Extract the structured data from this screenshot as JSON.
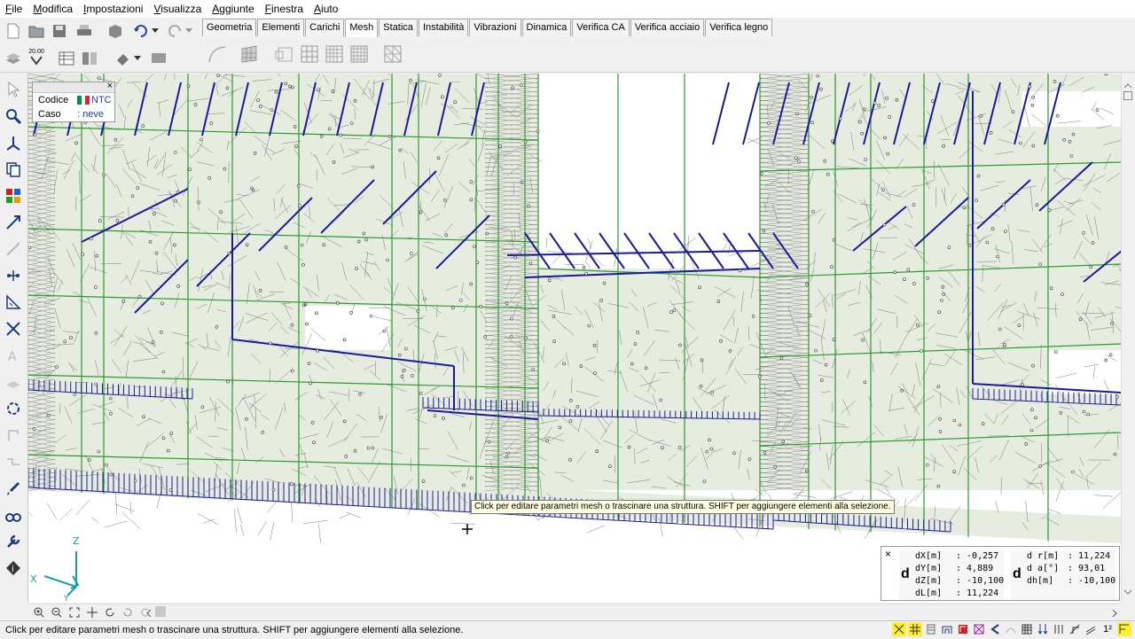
{
  "menu": {
    "items": [
      {
        "label": "File",
        "u": "F",
        "rest": "ile"
      },
      {
        "label": "Modifica",
        "u": "M",
        "rest": "odifica"
      },
      {
        "label": "Impostazioni",
        "u": "I",
        "rest": "mpostazioni"
      },
      {
        "label": "Visualizza",
        "u": "V",
        "rest": "isualizza"
      },
      {
        "label": "Aggiunte",
        "u": "A",
        "rest": "ggiunte"
      },
      {
        "label": "Finestra",
        "u": "F",
        "rest": "inestra"
      },
      {
        "label": "Aiuto",
        "u": "A",
        "rest": "iuto"
      }
    ]
  },
  "tabs": {
    "items": [
      "Geometria",
      "Elementi",
      "Carichi",
      "Mesh",
      "Statica",
      "Instabilità",
      "Vibrazioni",
      "Dinamica",
      "Verifica CA",
      "Verifica acciaio",
      "Verifica legno"
    ],
    "active": "Mesh"
  },
  "toolbar": {
    "zoom_value": "20.00"
  },
  "info_panel": {
    "codice_label": "Codice",
    "codice_value": "NTC",
    "caso_label": "Caso",
    "caso_value": ": neve",
    "close": "×"
  },
  "tooltip": "Click per editare parametri mesh o trascinare una struttura. SHIFT per aggiungere elementi alla selezione.",
  "status": "Click per editare parametri mesh o trascinare una struttura. SHIFT per aggiungere elementi alla selezione.",
  "coords": {
    "close": "×",
    "d_symbol": "d",
    "left": [
      {
        "k": "dX[m]",
        "v": ": -0,257"
      },
      {
        "k": "dY[m]",
        "v": ": 4,889"
      },
      {
        "k": "dZ[m]",
        "v": ": -10,100"
      },
      {
        "k": "dL[m]",
        "v": ": 11,224"
      }
    ],
    "right": [
      {
        "k": "d r[m]",
        "v": ": 11,224"
      },
      {
        "k": "d a[°]",
        "v": ": 93,01"
      },
      {
        "k": "dh[m]",
        "v": ": -10,100"
      }
    ]
  },
  "axes": {
    "z": "Z",
    "x": "X",
    "y": "Y"
  },
  "status_page": "1²",
  "colors": {
    "mesh_green": "#2e9a2e",
    "mesh_gray": "#7a7a7a",
    "beam_blue": "#1a1a9a",
    "wall_fill": "#e6ecdf"
  }
}
